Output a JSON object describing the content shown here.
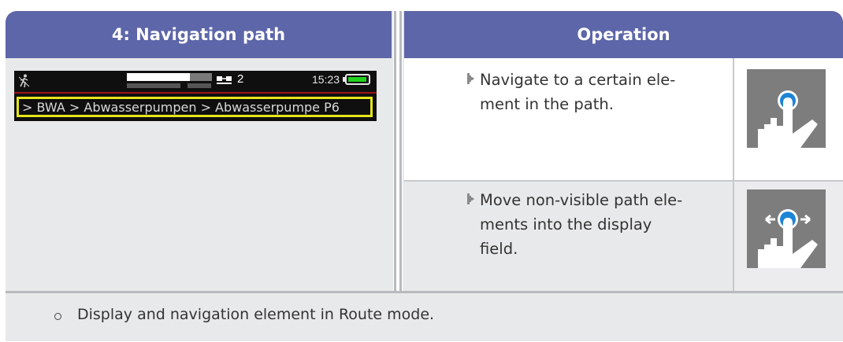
{
  "header": {
    "left_title": "4: Navigation path",
    "right_title": "Operation"
  },
  "device": {
    "count": "2",
    "time": "15:23",
    "battery_level": 0.95,
    "battery_color": "#22d11c",
    "path_text": "> BWA > Abwasserpumpen > Abwasserpumpe P6",
    "icons": [
      "person-walk-icon",
      "route-icon",
      "battery-icon"
    ]
  },
  "operations": [
    {
      "text": "Navigate to a certain ele-\nment in the path.",
      "gesture_icon": "tap-gesture-icon"
    },
    {
      "text": "Move non-visible path ele-\nments into the display\nfield.",
      "gesture_icon": "swipe-gesture-icon"
    }
  ],
  "footer": {
    "text": "Display and navigation element in Route mode."
  },
  "colors": {
    "header_bg": "#5d66a8",
    "cell_gray": "#e8e9ea",
    "highlight": "#e5e51a",
    "status_red": "#a0121a"
  }
}
